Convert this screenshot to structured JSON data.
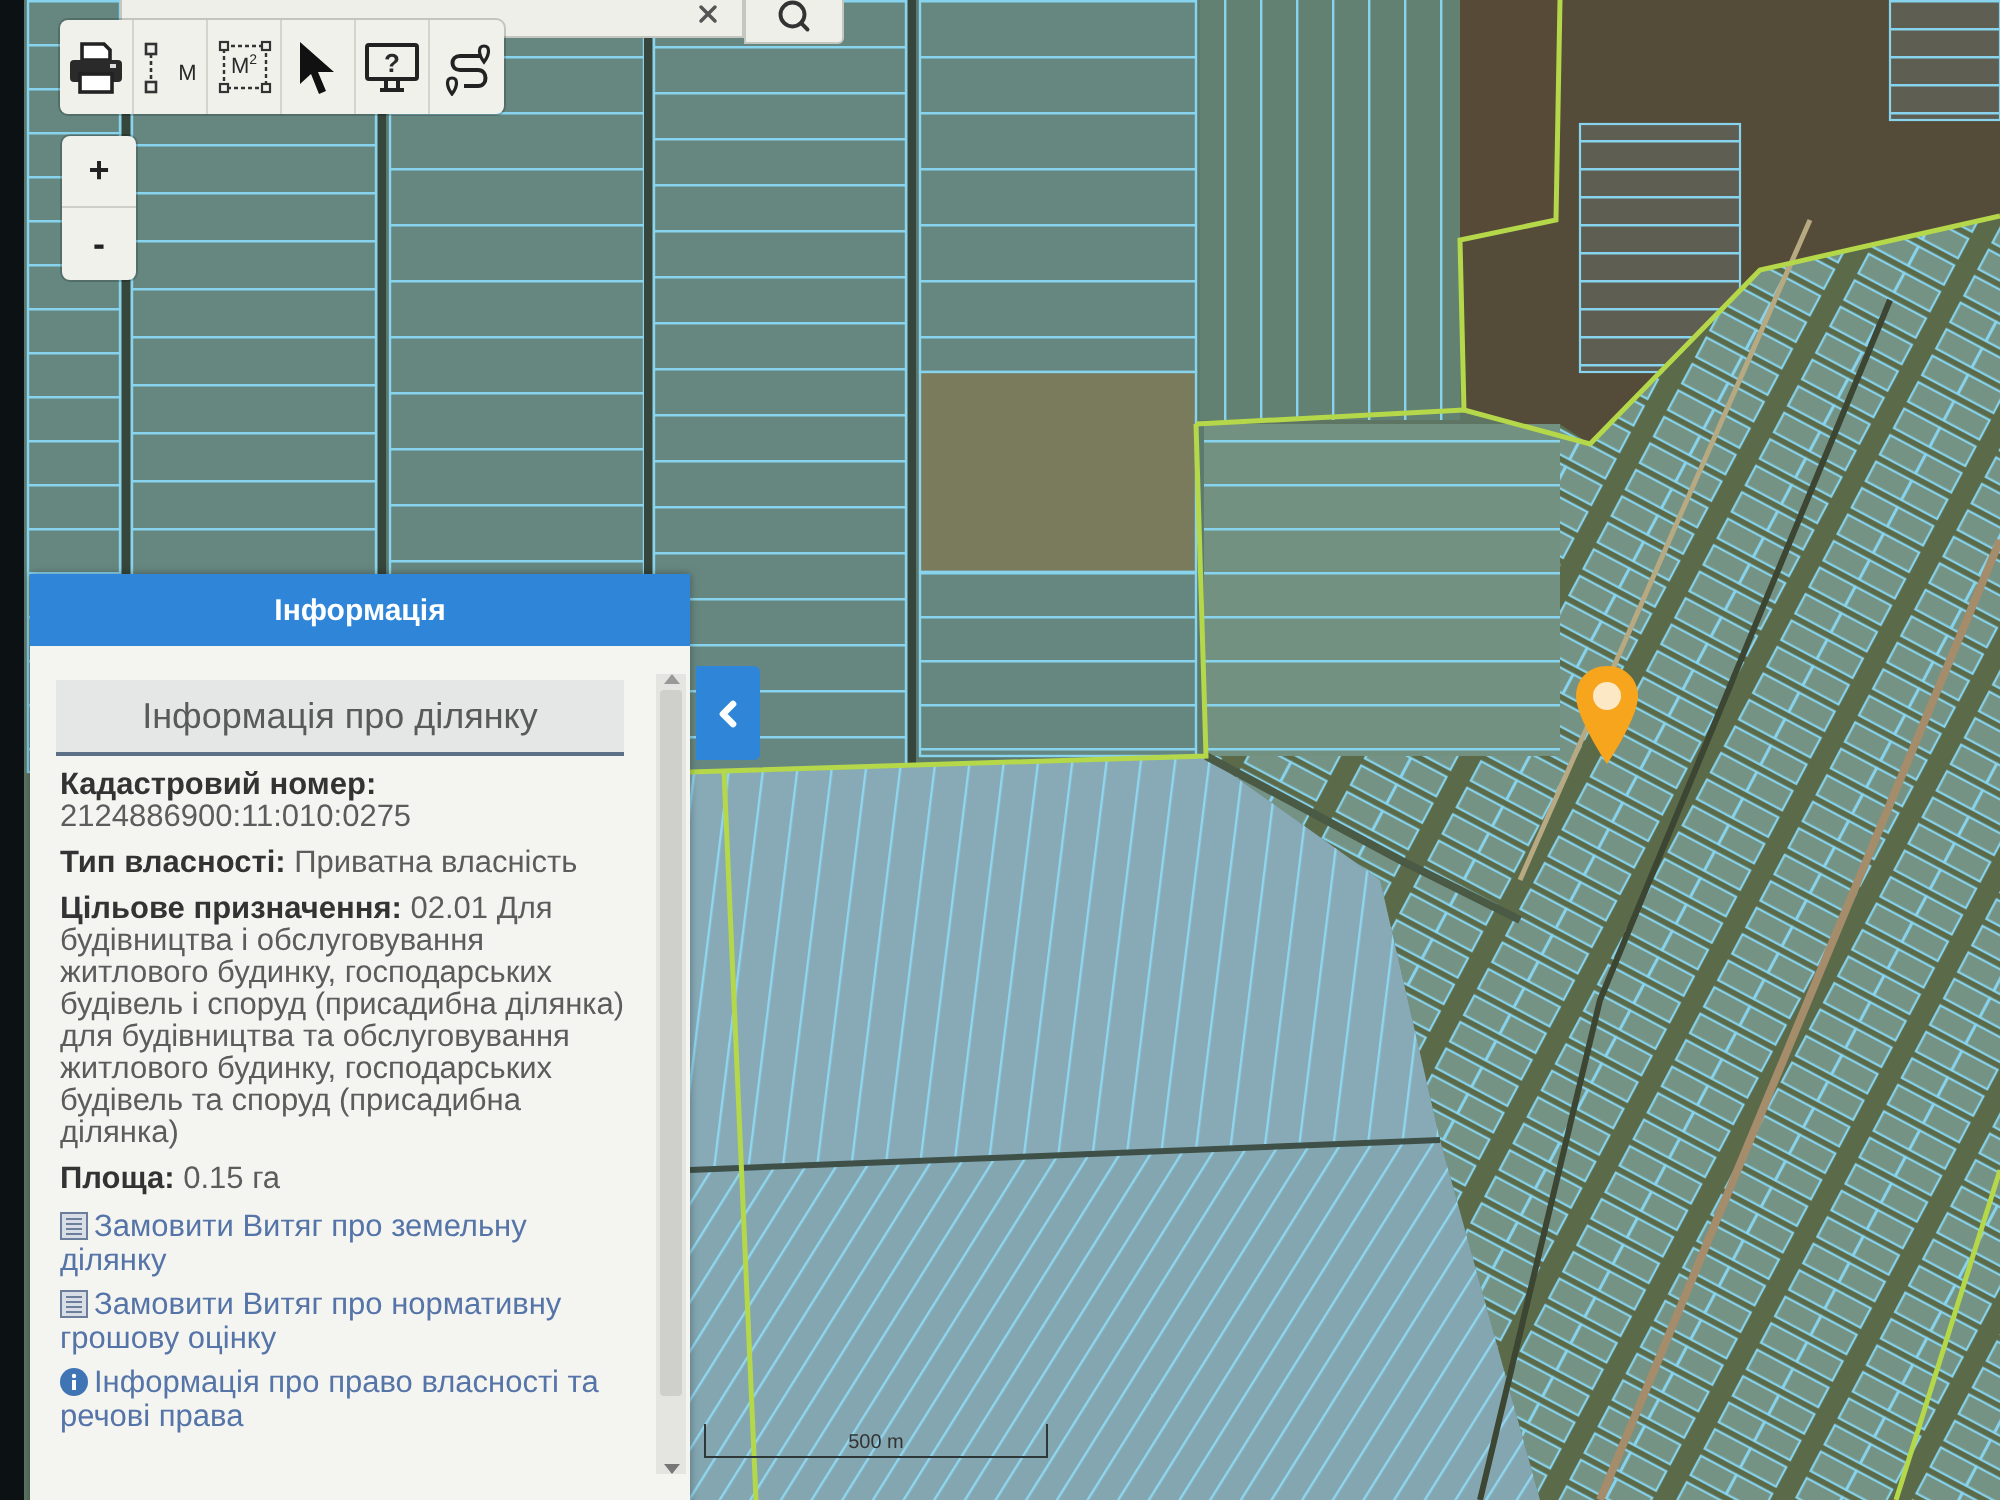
{
  "toolbar": [
    {
      "kind": "print"
    },
    {
      "kind": "distance",
      "label": "М"
    },
    {
      "kind": "area",
      "label": "М$^{2}$"
    },
    {
      "kind": "pointer"
    },
    {
      "kind": "help",
      "label": "?"
    },
    {
      "kind": "route"
    }
  ],
  "zoom_controls": [
    {
      "label": "+"
    },
    {
      "label": "-"
    }
  ],
  "info_panel": {
    "title": "Інформація",
    "section_title": "Інформація про ділянку",
    "fields": [
      {
        "label": "Кадастровий номер:",
        "value": "2124886900:11:010:0275"
      },
      {
        "label": "Тип власності:",
        "value": "Приватна власність"
      },
      {
        "label": "Цільове призначення:",
        "value": "02.01 Для будівництва і обслуговування житлового будинку, господарських будівель і споруд (присадибна ділянка) для будівництва та обслуговування житлового будинку, господарських будівель та споруд (присадибна ділянка)"
      },
      {
        "label": "Площа:",
        "value": "0.15 га"
      }
    ],
    "links": [
      {
        "kind": "document",
        "text": "Замовити Витяг про земельну ділянку"
      },
      {
        "kind": "document",
        "text": "Замовити Витяг про нормативну грошову оцінку"
      },
      {
        "kind": "info",
        "text": "Інформація про право власності та речові права"
      }
    ]
  },
  "scale_bar": {
    "label": "500 m"
  }
}
